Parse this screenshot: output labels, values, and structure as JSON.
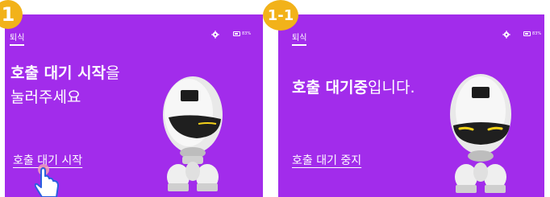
{
  "step1": {
    "badge": "1",
    "topbar": {
      "title": "퇴식",
      "battery_text": "83%"
    },
    "headline": {
      "bold": "호출 대기 시작",
      "suffix": "을",
      "line2": "눌러주세요"
    },
    "action_label": "호출 대기 시작"
  },
  "step2": {
    "badge": "1-1",
    "topbar": {
      "title": "퇴식",
      "battery_text": "83%"
    },
    "headline": {
      "bold": "호출 대기중",
      "suffix": "입니다."
    },
    "action_label": "호출 대기 중지"
  },
  "colors": {
    "background": "#a22ceb",
    "badge": "#f2b21a",
    "robot_eyes": "#f5d21a"
  }
}
